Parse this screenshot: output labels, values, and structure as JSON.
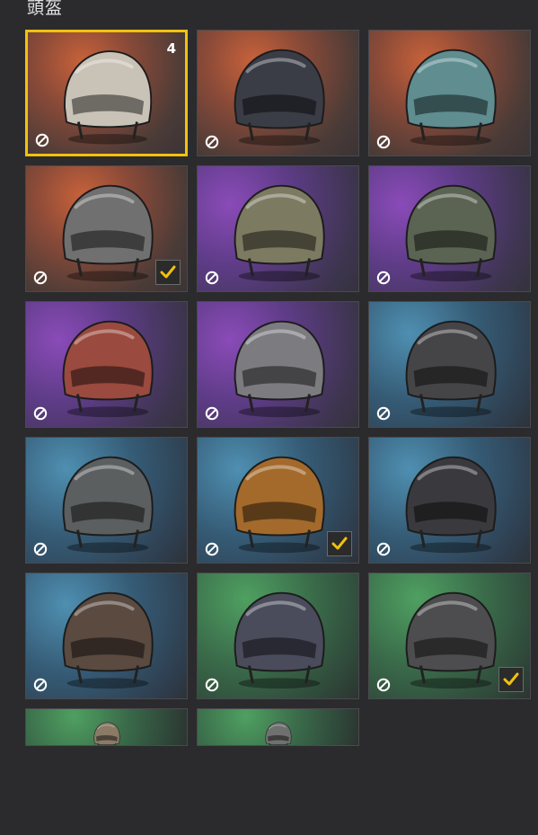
{
  "section_title": "頭盔",
  "colors": {
    "selected_border": "#f2c10f",
    "check": "#f2c10f"
  },
  "cards": [
    {
      "bg": "orange",
      "helmet": "pilot-helmet",
      "count": "4",
      "selected": true,
      "equipped": false,
      "tone": "#c9c2b6"
    },
    {
      "bg": "orange",
      "helmet": "motorcycle-visor-helmet",
      "count": "",
      "selected": false,
      "equipped": false,
      "tone": "#3a3d45"
    },
    {
      "bg": "orange",
      "helmet": "level3-camo-helmet",
      "count": "",
      "selected": false,
      "equipped": false,
      "tone": "#5f8d90"
    },
    {
      "bg": "orange",
      "helmet": "skull-mask-helmet",
      "count": "",
      "selected": false,
      "equipped": true,
      "tone": "#707070"
    },
    {
      "bg": "purple",
      "helmet": "aviator-goggles-helmet",
      "count": "",
      "selected": false,
      "equipped": false,
      "tone": "#7d7a62"
    },
    {
      "bg": "purple",
      "helmet": "goggles-military-helmet",
      "count": "",
      "selected": false,
      "equipped": false,
      "tone": "#5b6453"
    },
    {
      "bg": "purple",
      "helmet": "red-camo-helmet",
      "count": "",
      "selected": false,
      "equipped": false,
      "tone": "#9a4a3e"
    },
    {
      "bg": "purple",
      "helmet": "hexagon-pattern-helmet",
      "count": "",
      "selected": false,
      "equipped": false,
      "tone": "#7c7c80"
    },
    {
      "bg": "blue",
      "helmet": "checkered-helmet",
      "count": "",
      "selected": false,
      "equipped": false,
      "tone": "#454548"
    },
    {
      "bg": "blue",
      "helmet": "winged-helmet",
      "count": "",
      "selected": false,
      "equipped": false,
      "tone": "#5c5f60"
    },
    {
      "bg": "blue",
      "helmet": "leopard-print-helmet",
      "count": "",
      "selected": false,
      "equipped": true,
      "tone": "#a36a2c"
    },
    {
      "bg": "blue",
      "helmet": "spiderweb-helmet",
      "count": "",
      "selected": false,
      "equipped": false,
      "tone": "#3a3a3e"
    },
    {
      "bg": "blue",
      "helmet": "spiked-helmet",
      "count": "",
      "selected": false,
      "equipped": false,
      "tone": "#5a4a40"
    },
    {
      "bg": "green",
      "helmet": "visor-dark-helmet",
      "count": "",
      "selected": false,
      "equipped": false,
      "tone": "#4a4c5c"
    },
    {
      "bg": "green",
      "helmet": "gold-goggles-helmet",
      "count": "",
      "selected": false,
      "equipped": true,
      "tone": "#4d4d4f"
    },
    {
      "bg": "green",
      "helmet": "partial-helmet",
      "count": "",
      "selected": false,
      "equipped": false,
      "tone": "#8a7a66",
      "partial": true
    },
    {
      "bg": "green",
      "helmet": "partial-helmet",
      "count": "",
      "selected": false,
      "equipped": false,
      "tone": "#707070",
      "partial": true
    }
  ]
}
